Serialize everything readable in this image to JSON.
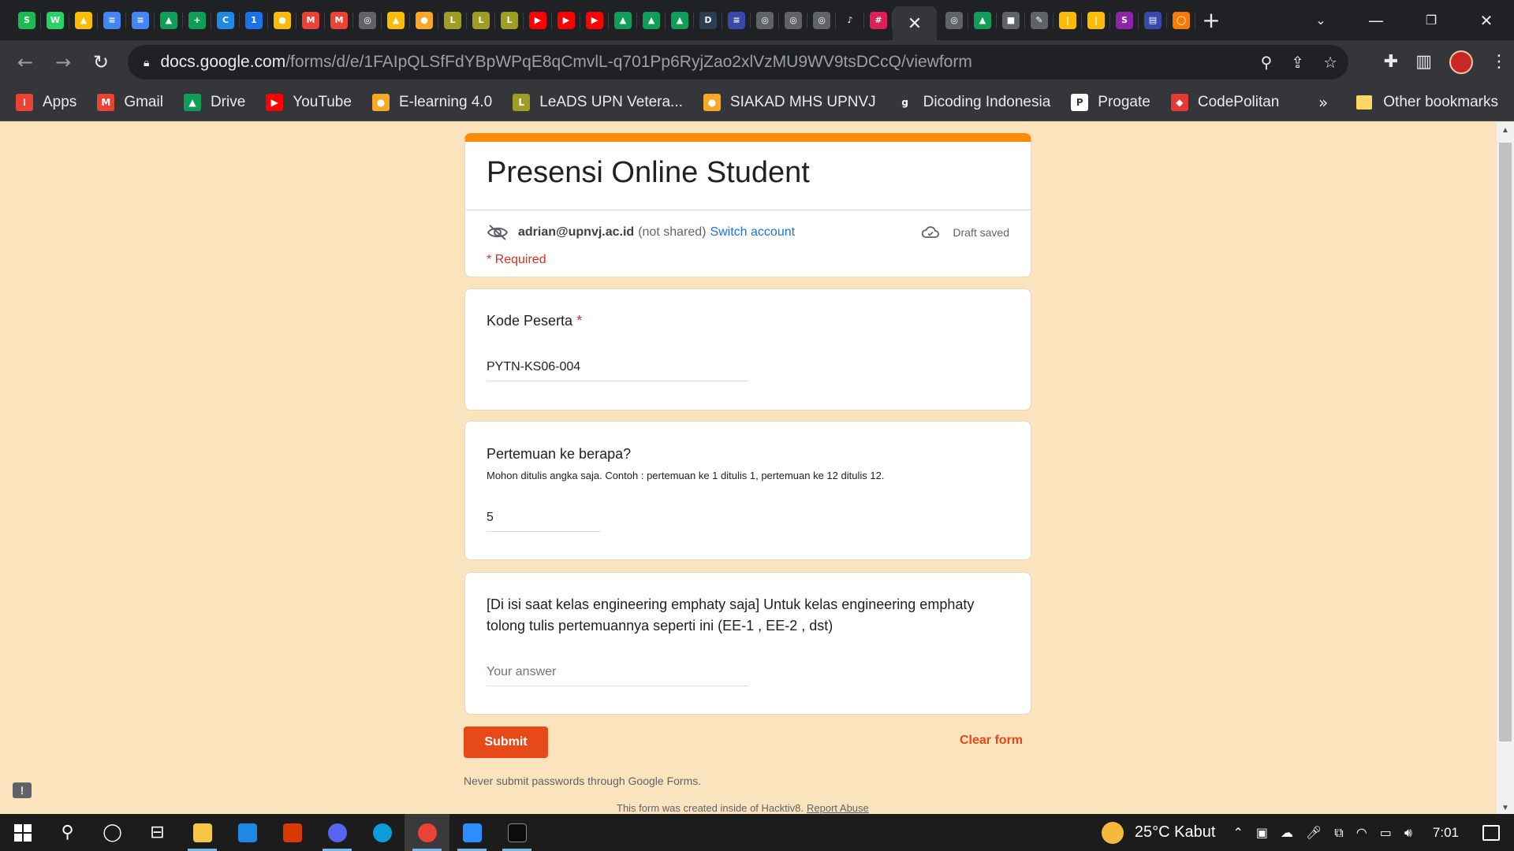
{
  "browser": {
    "tab_favicons": [
      {
        "name": "spotify",
        "color": "#1db954",
        "glyph": "S"
      },
      {
        "name": "whatsapp",
        "color": "#25d366",
        "glyph": "W"
      },
      {
        "name": "drive",
        "color": "#fbbc04",
        "glyph": "▲"
      },
      {
        "name": "docs",
        "color": "#4285f4",
        "glyph": "≡"
      },
      {
        "name": "docs",
        "color": "#4285f4",
        "glyph": "≡"
      },
      {
        "name": "drive",
        "color": "#0f9d58",
        "glyph": "▲"
      },
      {
        "name": "sheets-plus",
        "color": "#0f9d58",
        "glyph": "+"
      },
      {
        "name": "c-app",
        "color": "#1e88e5",
        "glyph": "C"
      },
      {
        "name": "calendar",
        "color": "#1a73e8",
        "glyph": "1"
      },
      {
        "name": "keep",
        "color": "#fbbc04",
        "glyph": "●"
      },
      {
        "name": "gmail",
        "color": "#ea4335",
        "glyph": "M"
      },
      {
        "name": "gmail",
        "color": "#ea4335",
        "glyph": "M"
      },
      {
        "name": "globe",
        "color": "#5f6368",
        "glyph": "◎"
      },
      {
        "name": "drive",
        "color": "#fbbc04",
        "glyph": "▲"
      },
      {
        "name": "siakad",
        "color": "#f9a825",
        "glyph": "●"
      },
      {
        "name": "leads",
        "color": "#9e9d24",
        "glyph": "L"
      },
      {
        "name": "leads",
        "color": "#9e9d24",
        "glyph": "L"
      },
      {
        "name": "leads",
        "color": "#9e9d24",
        "glyph": "L"
      },
      {
        "name": "youtube",
        "color": "#ff0000",
        "glyph": "▶"
      },
      {
        "name": "youtube",
        "color": "#ff0000",
        "glyph": "▶"
      },
      {
        "name": "youtube",
        "color": "#ff0000",
        "glyph": "▶"
      },
      {
        "name": "drive",
        "color": "#0f9d58",
        "glyph": "▲"
      },
      {
        "name": "drive",
        "color": "#0f9d58",
        "glyph": "▲"
      },
      {
        "name": "drive",
        "color": "#0f9d58",
        "glyph": "▲"
      },
      {
        "name": "dicoding",
        "color": "#2d3e50",
        "glyph": "D"
      },
      {
        "name": "site",
        "color": "#3949ab",
        "glyph": "≡"
      },
      {
        "name": "globe",
        "color": "#5f6368",
        "glyph": "◎"
      },
      {
        "name": "globe",
        "color": "#5f6368",
        "glyph": "◎"
      },
      {
        "name": "globe",
        "color": "#5f6368",
        "glyph": "◎"
      },
      {
        "name": "tiktok",
        "color": "#202124",
        "glyph": "♪"
      },
      {
        "name": "slack",
        "color": "#e01e5a",
        "glyph": "#"
      }
    ],
    "tab_favicons_after": [
      {
        "name": "globe",
        "color": "#5f6368",
        "glyph": "◎"
      },
      {
        "name": "drive",
        "color": "#0f9d58",
        "glyph": "▲"
      },
      {
        "name": "contacts",
        "color": "#5f6368",
        "glyph": "■"
      },
      {
        "name": "pencil",
        "color": "#5f6368",
        "glyph": "✎"
      },
      {
        "name": "bars",
        "color": "#fbbc04",
        "glyph": "|"
      },
      {
        "name": "bars",
        "color": "#fbbc04",
        "glyph": "|"
      },
      {
        "name": "swirl",
        "color": "#8e24aa",
        "glyph": "S"
      },
      {
        "name": "chart",
        "color": "#3949ab",
        "glyph": "▤"
      },
      {
        "name": "ring",
        "color": "#f57c00",
        "glyph": "◯"
      }
    ],
    "url_host": "docs.google.com",
    "url_path": "/forms/d/e/1FAIpQLSfFdYBpWPqE8qCmvlL-q701Pp6RyjZao2xlVzMU9WV9tsDCcQ/viewform",
    "bookmarks": [
      {
        "label": "Apps",
        "color": "#ea4335",
        "glyph": "⁞"
      },
      {
        "label": "Gmail",
        "color": "#ea4335",
        "glyph": "M"
      },
      {
        "label": "Drive",
        "color": "#0f9d58",
        "glyph": "▲"
      },
      {
        "label": "YouTube",
        "color": "#ff0000",
        "glyph": "▶"
      },
      {
        "label": "E-learning 4.0",
        "color": "#f9a825",
        "glyph": "●"
      },
      {
        "label": "LeADS UPN Vetera...",
        "color": "#9e9d24",
        "glyph": "L"
      },
      {
        "label": "SIAKAD MHS UPNVJ",
        "color": "#f9a825",
        "glyph": "●"
      },
      {
        "label": "Dicoding Indonesia",
        "color": "#35363a",
        "glyph": "g"
      },
      {
        "label": "Progate",
        "color": "#ffffff",
        "glyph": "P"
      },
      {
        "label": "CodePolitan",
        "color": "#e53935",
        "glyph": "◆"
      }
    ],
    "other_bookmarks": "Other bookmarks"
  },
  "form": {
    "accent_color": "#fb8c00",
    "title": "Presensi Online Student",
    "account_email": "adrian@upnvj.ac.id",
    "not_shared": "(not shared)",
    "switch_account": "Switch account",
    "draft_status": "Draft saved",
    "required_note": "* Required",
    "questions": [
      {
        "title": "Kode Peserta",
        "required_mark": "*",
        "value": "PYTN-KS06-004"
      },
      {
        "title": "Pertemuan ke berapa?",
        "help": "Mohon ditulis angka saja. Contoh : pertemuan ke 1 ditulis 1, pertemuan ke 12 ditulis 12.",
        "value": "5"
      },
      {
        "title": "[Di isi saat kelas engineering emphaty saja] Untuk kelas engineering emphaty tolong tulis pertemuannya seperti ini (EE-1 , EE-2 , dst)",
        "placeholder": "Your answer"
      }
    ],
    "submit_label": "Submit",
    "clear_label": "Clear form",
    "footer_warning": "Never submit passwords through Google Forms.",
    "footer_created": "This form was created inside of Hacktiv8.",
    "report_abuse": "Report Abuse"
  },
  "taskbar": {
    "temperature": "25°C",
    "weather": "Kabut",
    "time": "7:01"
  }
}
